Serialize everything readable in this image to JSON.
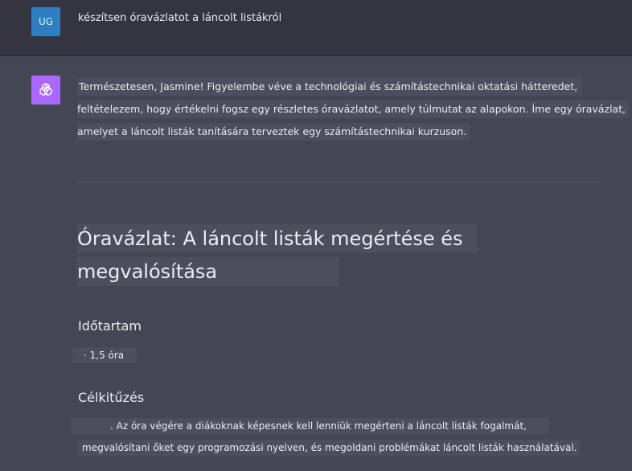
{
  "user": {
    "avatar": "UG",
    "message": "készítsen óravázlatot a láncolt listákról"
  },
  "assistant": {
    "avatar_icon": "openai-logo-icon",
    "intro_lines": [
      "Természetesen, Jasmine! Figyelembe véve a technológiai és számítástechnikai oktatási hátteredet,",
      "feltételezem, hogy értékelni fogsz egy részletes óravázlatot, amely túlmutat az alapokon. Íme egy óravázlat,",
      "amelyet a láncolt listák tanítására terveztek egy számítástechnikai kurzuson."
    ],
    "title_lines": [
      "Óravázlat: A láncolt listák megértése és",
      "megvalósítása"
    ],
    "duration_heading": "Időtartam",
    "duration_item": "· 1,5 óra",
    "objective_heading": "Célkitűzés",
    "objective_lines": [
      ". Az óra végére a diákoknak képesnek kell lenniük megérteni a láncolt listák fogalmát,",
      "megvalósítani őket egy programozási nyelven, és megoldani problémákat láncolt listák használatával."
    ]
  },
  "colors": {
    "user_avatar": "#2d7fbf",
    "assistant_avatar": "#ab68ff",
    "background": "#444654",
    "user_row": "#343541"
  }
}
